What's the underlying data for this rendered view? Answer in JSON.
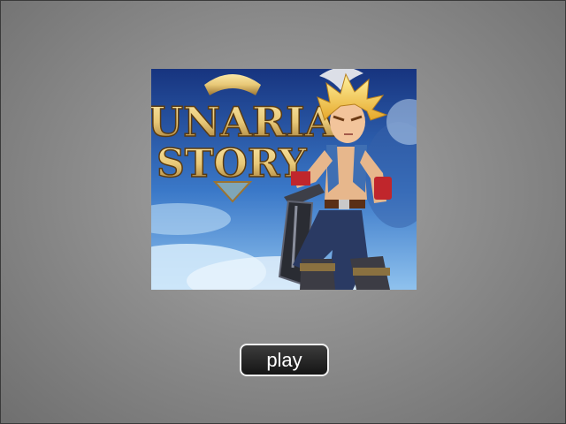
{
  "game": {
    "logo_line1": "UNARIA",
    "logo_line2": "STORY",
    "play_label": "play"
  },
  "colors": {
    "background_center": "#a8a8a8",
    "background_edge": "#6f6f6f",
    "button_fill": "#222222",
    "button_border": "#f0f0f0",
    "logo_gold": "#e8c877"
  },
  "icons": [
    "hero-character",
    "sword",
    "wing-emblem"
  ]
}
